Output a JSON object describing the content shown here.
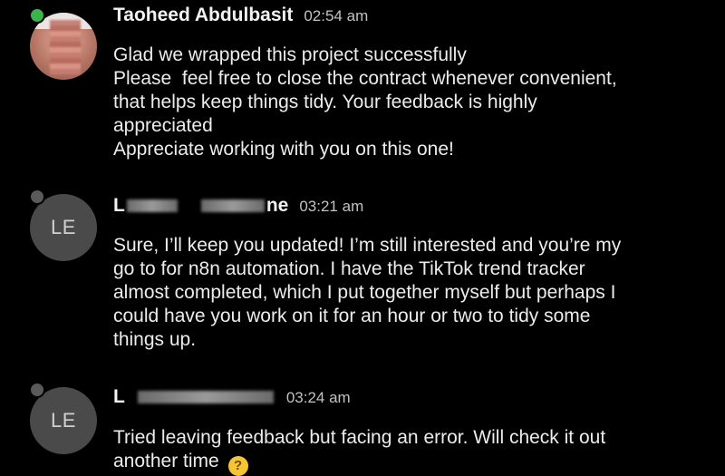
{
  "messages": [
    {
      "sender": "Taoheed Abdulbasit",
      "time": "02:54 am",
      "status": "online",
      "avatar_type": "photo",
      "lines": [
        "Glad we wrapped this project successfully",
        "Please  feel free to close the contract whenever convenient,",
        "that helps keep things tidy. Your feedback is highly",
        "appreciated",
        "Appreciate working with you on this one!"
      ]
    },
    {
      "sender_prefix": "L",
      "sender_suffix": "ne",
      "time": "03:21 am",
      "status": "offline",
      "avatar_initials": "LE",
      "lines": [
        "Sure, I’ll keep you updated! I’m still interested and you’re my",
        "go to for n8n automation. I have the TikTok trend tracker",
        "almost completed, which I put together myself but perhaps I",
        "could have you work on it for an hour or two to tidy some",
        "things up."
      ]
    },
    {
      "sender_prefix": "L",
      "sender_suffix": "",
      "time": "03:24 am",
      "status": "offline",
      "avatar_initials": "LE",
      "lines": [
        "Tried leaving feedback but facing an error. Will check it out",
        "another time"
      ],
      "trailing_emoji": "thinking-face-emoji"
    }
  ],
  "colors": {
    "background": "#000000",
    "online_status": "#3bb54a",
    "offline_status": "#5a5a5a",
    "avatar_placeholder": "#4a4a4a"
  }
}
